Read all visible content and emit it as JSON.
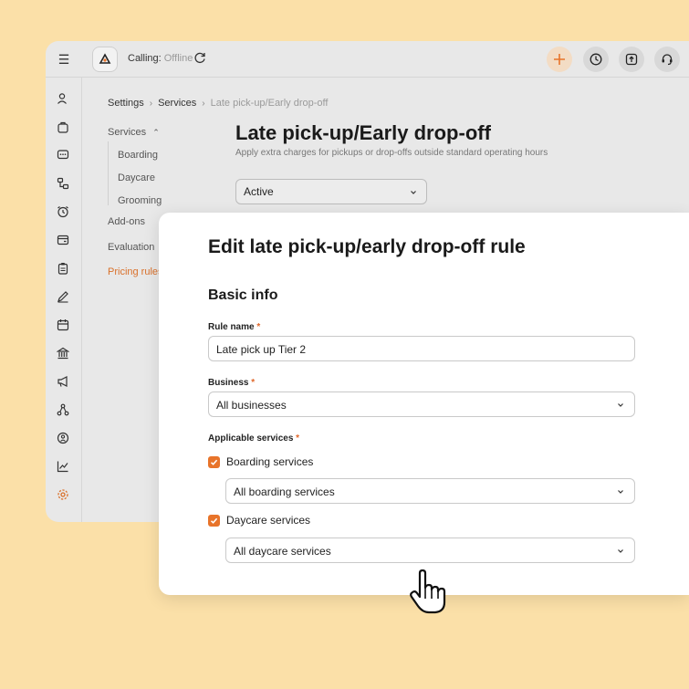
{
  "topbar": {
    "calling_label": "Calling:",
    "calling_status": "Offline",
    "icons": [
      "menu-icon",
      "logo-icon",
      "refresh-icon",
      "add-icon",
      "clock-icon",
      "upload-icon",
      "headset-icon"
    ]
  },
  "sidebar": {
    "icons": [
      "user-icon",
      "bag-icon",
      "chat-icon",
      "flow-icon",
      "alarm-icon",
      "wallet-icon",
      "clipboard-icon",
      "pen-icon",
      "calendar-icon",
      "bank-icon",
      "megaphone-icon",
      "network-icon",
      "badge-icon",
      "chart-icon",
      "gear-icon"
    ]
  },
  "breadcrumb": {
    "items": [
      "Settings",
      "Services",
      "Late pick-up/Early drop-off"
    ]
  },
  "subnav": {
    "services": "Services",
    "boarding": "Boarding",
    "daycare": "Daycare",
    "grooming": "Grooming",
    "addons": "Add-ons",
    "evaluation": "Evaluation",
    "pricing_rules": "Pricing rules"
  },
  "page": {
    "title": "Late pick-up/Early drop-off",
    "subtitle": "Apply extra charges for pickups or drop-offs outside standard operating hours",
    "status_value": "Active"
  },
  "modal": {
    "title": "Edit late pick-up/early drop-off rule",
    "section": "Basic info",
    "rule_name_label": "Rule name",
    "rule_name_value": "Late pick up Tier 2",
    "business_label": "Business",
    "business_value": "All businesses",
    "services_label": "Applicable services",
    "required_mark": "*",
    "boarding_label": "Boarding services",
    "boarding_value": "All boarding services",
    "daycare_label": "Daycare services",
    "daycare_value": "All daycare services"
  },
  "colors": {
    "accent": "#e8742a",
    "background": "#fbe0a8"
  }
}
